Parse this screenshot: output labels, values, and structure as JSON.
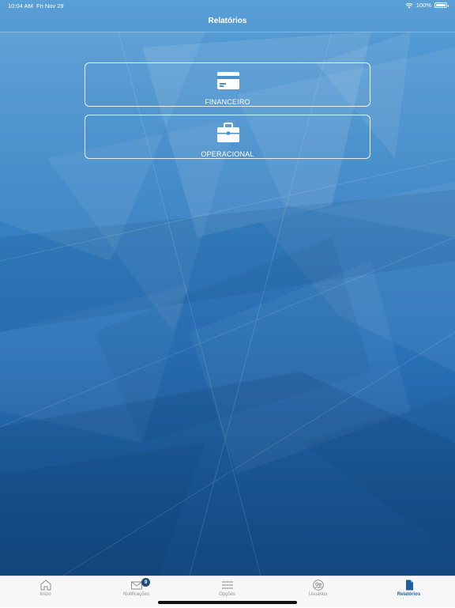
{
  "status_bar": {
    "time": "10:04 AM",
    "date": "Fri Nov 29",
    "battery": "100%"
  },
  "nav": {
    "title": "Relatórios"
  },
  "cards": [
    {
      "label": "FINANCEIRO",
      "icon": "credit-card-icon"
    },
    {
      "label": "OPERACIONAL",
      "icon": "briefcase-icon"
    }
  ],
  "tabs": [
    {
      "label": "Início",
      "icon": "home-icon"
    },
    {
      "label": "Notificações",
      "icon": "envelope-icon",
      "badge": "9"
    },
    {
      "label": "Opções",
      "icon": "menu-icon"
    },
    {
      "label": "Usuários",
      "icon": "users-icon"
    },
    {
      "label": "Relatórios",
      "icon": "document-icon",
      "active": true
    }
  ],
  "colors": {
    "active_tab": "#1f5f9e",
    "badge": "#1f4e7a",
    "background_top": "#5a9fd6",
    "background_bottom": "#154b86"
  }
}
